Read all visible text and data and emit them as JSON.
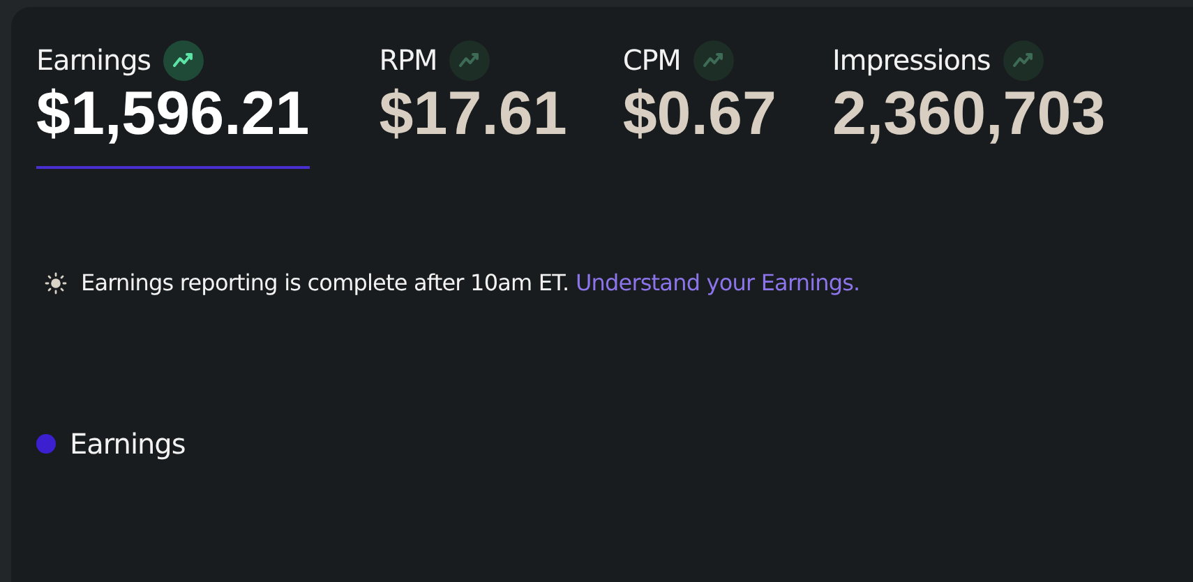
{
  "metrics": [
    {
      "label": "Earnings",
      "value": "$1,596.21",
      "selected": true
    },
    {
      "label": "RPM",
      "value": "$17.61",
      "selected": false
    },
    {
      "label": "CPM",
      "value": "$0.67",
      "selected": false
    },
    {
      "label": "Impressions",
      "value": "2,360,703",
      "selected": false
    }
  ],
  "notice": {
    "text": "Earnings reporting is complete after 10am ET.",
    "link": "Understand your Earnings."
  },
  "legend": [
    {
      "label": "Earnings",
      "color": "#3c1fcf"
    }
  ]
}
